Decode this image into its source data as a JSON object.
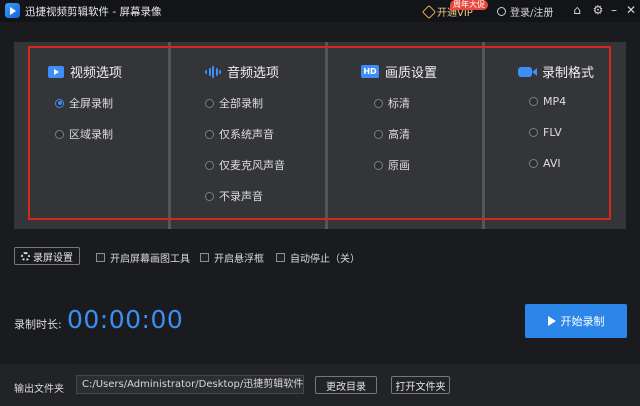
{
  "window": {
    "title": "迅捷视频剪辑软件 - 屏幕录像",
    "vip_label": "开通VIP",
    "vip_badge": "周年大促",
    "login_label": "登录/注册",
    "controls": [
      "home-icon",
      "settings-icon",
      "minimize-icon",
      "close-icon"
    ]
  },
  "sections": [
    {
      "title": "视频选项",
      "icon": "video-icon",
      "options": [
        {
          "label": "全屏录制",
          "selected": true
        },
        {
          "label": "区域录制",
          "selected": false
        }
      ]
    },
    {
      "title": "音频选项",
      "icon": "audio-wave-icon",
      "options": [
        {
          "label": "全部录制",
          "selected": false
        },
        {
          "label": "仅系统声音",
          "selected": false
        },
        {
          "label": "仅麦克风声音",
          "selected": false
        },
        {
          "label": "不录声音",
          "selected": false
        }
      ]
    },
    {
      "title": "画质设置",
      "icon": "hd-icon",
      "options": [
        {
          "label": "标清",
          "selected": false
        },
        {
          "label": "高清",
          "selected": false
        },
        {
          "label": "原画",
          "selected": false
        }
      ]
    },
    {
      "title": "录制格式",
      "icon": "camera-icon",
      "options": [
        {
          "label": "MP4",
          "selected": false
        },
        {
          "label": "FLV",
          "selected": false
        },
        {
          "label": "AVI",
          "selected": false
        }
      ]
    }
  ],
  "toolbar": {
    "settings_label": "录屏设置",
    "checkboxes": [
      {
        "label": "开启屏幕画图工具",
        "checked": false
      },
      {
        "label": "开启悬浮框",
        "checked": false
      },
      {
        "label": "自动停止（关）",
        "checked": false
      }
    ]
  },
  "recording": {
    "duration_label": "录制时长:",
    "duration": "00:00:00",
    "start_label": "开始录制"
  },
  "output": {
    "label": "输出文件夹",
    "path": "C:/Users/Administrator/Desktop/迅捷剪辑软件",
    "change_dir_label": "更改目录",
    "open_folder_label": "打开文件夹"
  },
  "colors": {
    "accent": "#2b86e8",
    "highlight_frame": "#d8261c",
    "vip": "#ecc889"
  }
}
